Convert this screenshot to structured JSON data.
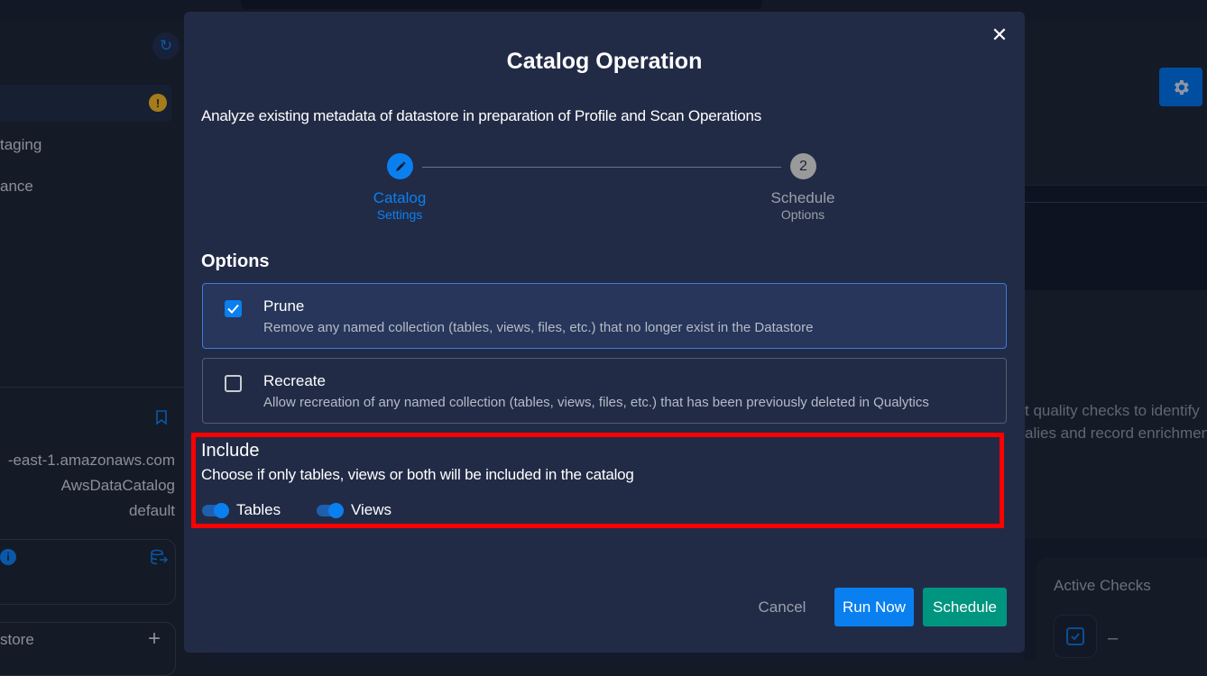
{
  "background": {
    "left_panel": {
      "items": [
        "taging",
        "ance"
      ],
      "details": [
        "-east-1.amazonaws.com",
        "AwsDataCatalog",
        "default"
      ],
      "datastore_label": "store"
    },
    "right_panel": {
      "description_lines": [
        "t quality checks to identify",
        "alies and record enrichmen"
      ],
      "active_checks_title": "Active Checks",
      "active_checks_value": "–"
    }
  },
  "modal": {
    "title": "Catalog Operation",
    "subtitle": "Analyze existing metadata of datastore in preparation of Profile and Scan Operations",
    "close_label": "✕",
    "stepper": {
      "steps": [
        {
          "label": "Catalog",
          "sublabel": "Settings",
          "state": "active"
        },
        {
          "number": "2",
          "label": "Schedule",
          "sublabel": "Options",
          "state": "pending"
        }
      ]
    },
    "options": {
      "heading": "Options",
      "items": [
        {
          "title": "Prune",
          "description": "Remove any named collection (tables, views, files, etc.) that no longer exist in the Datastore",
          "checked": true
        },
        {
          "title": "Recreate",
          "description": "Allow recreation of any named collection (tables, views, files, etc.) that has been previously deleted in Qualytics",
          "checked": false
        }
      ]
    },
    "include": {
      "title": "Include",
      "description": "Choose if only tables, views or both will be included in the catalog",
      "toggles": [
        {
          "label": "Tables",
          "on": true
        },
        {
          "label": "Views",
          "on": true
        }
      ]
    },
    "actions": {
      "cancel": "Cancel",
      "run_now": "Run Now",
      "schedule": "Schedule"
    }
  },
  "colors": {
    "accent": "#0a80f0",
    "schedule": "#00957f",
    "highlight": "#ff0000",
    "modal_bg": "#222b46"
  }
}
